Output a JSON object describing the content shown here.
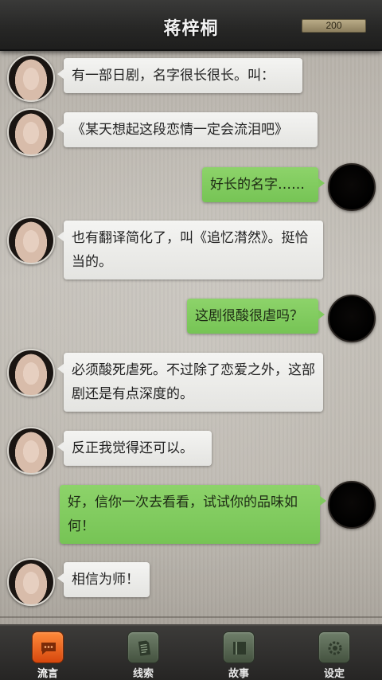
{
  "header": {
    "title": "蒋梓桐",
    "coins": "200"
  },
  "messages": [
    {
      "from": "her",
      "text": "有一部日剧，名字很长很长。叫："
    },
    {
      "from": "her",
      "text": "《某天想起这段恋情一定会流泪吧》"
    },
    {
      "from": "me",
      "text": "好长的名字……"
    },
    {
      "from": "her",
      "text": "也有翻译简化了，叫《追忆潸然》。挺恰当的。"
    },
    {
      "from": "me",
      "text": "这剧很酸很虐吗？"
    },
    {
      "from": "her",
      "text": "必须酸死虐死。不过除了恋爱之外，这部剧还是有点深度的。"
    },
    {
      "from": "her",
      "text": "反正我觉得还可以。"
    },
    {
      "from": "me",
      "text": "好，信你一次去看看，试试你的品味如何！"
    },
    {
      "from": "her",
      "text": "相信为师！"
    }
  ],
  "nav": {
    "items": [
      {
        "label": "流言",
        "icon": "chat-bubble-icon",
        "active": true
      },
      {
        "label": "线索",
        "icon": "notes-icon",
        "active": false
      },
      {
        "label": "故事",
        "icon": "book-icon",
        "active": false
      },
      {
        "label": "设定",
        "icon": "gear-icon",
        "active": false
      }
    ]
  },
  "colors": {
    "left_bubble": "#ededeb",
    "right_bubble": "#80c95e",
    "active_tab": "#e8621f"
  }
}
